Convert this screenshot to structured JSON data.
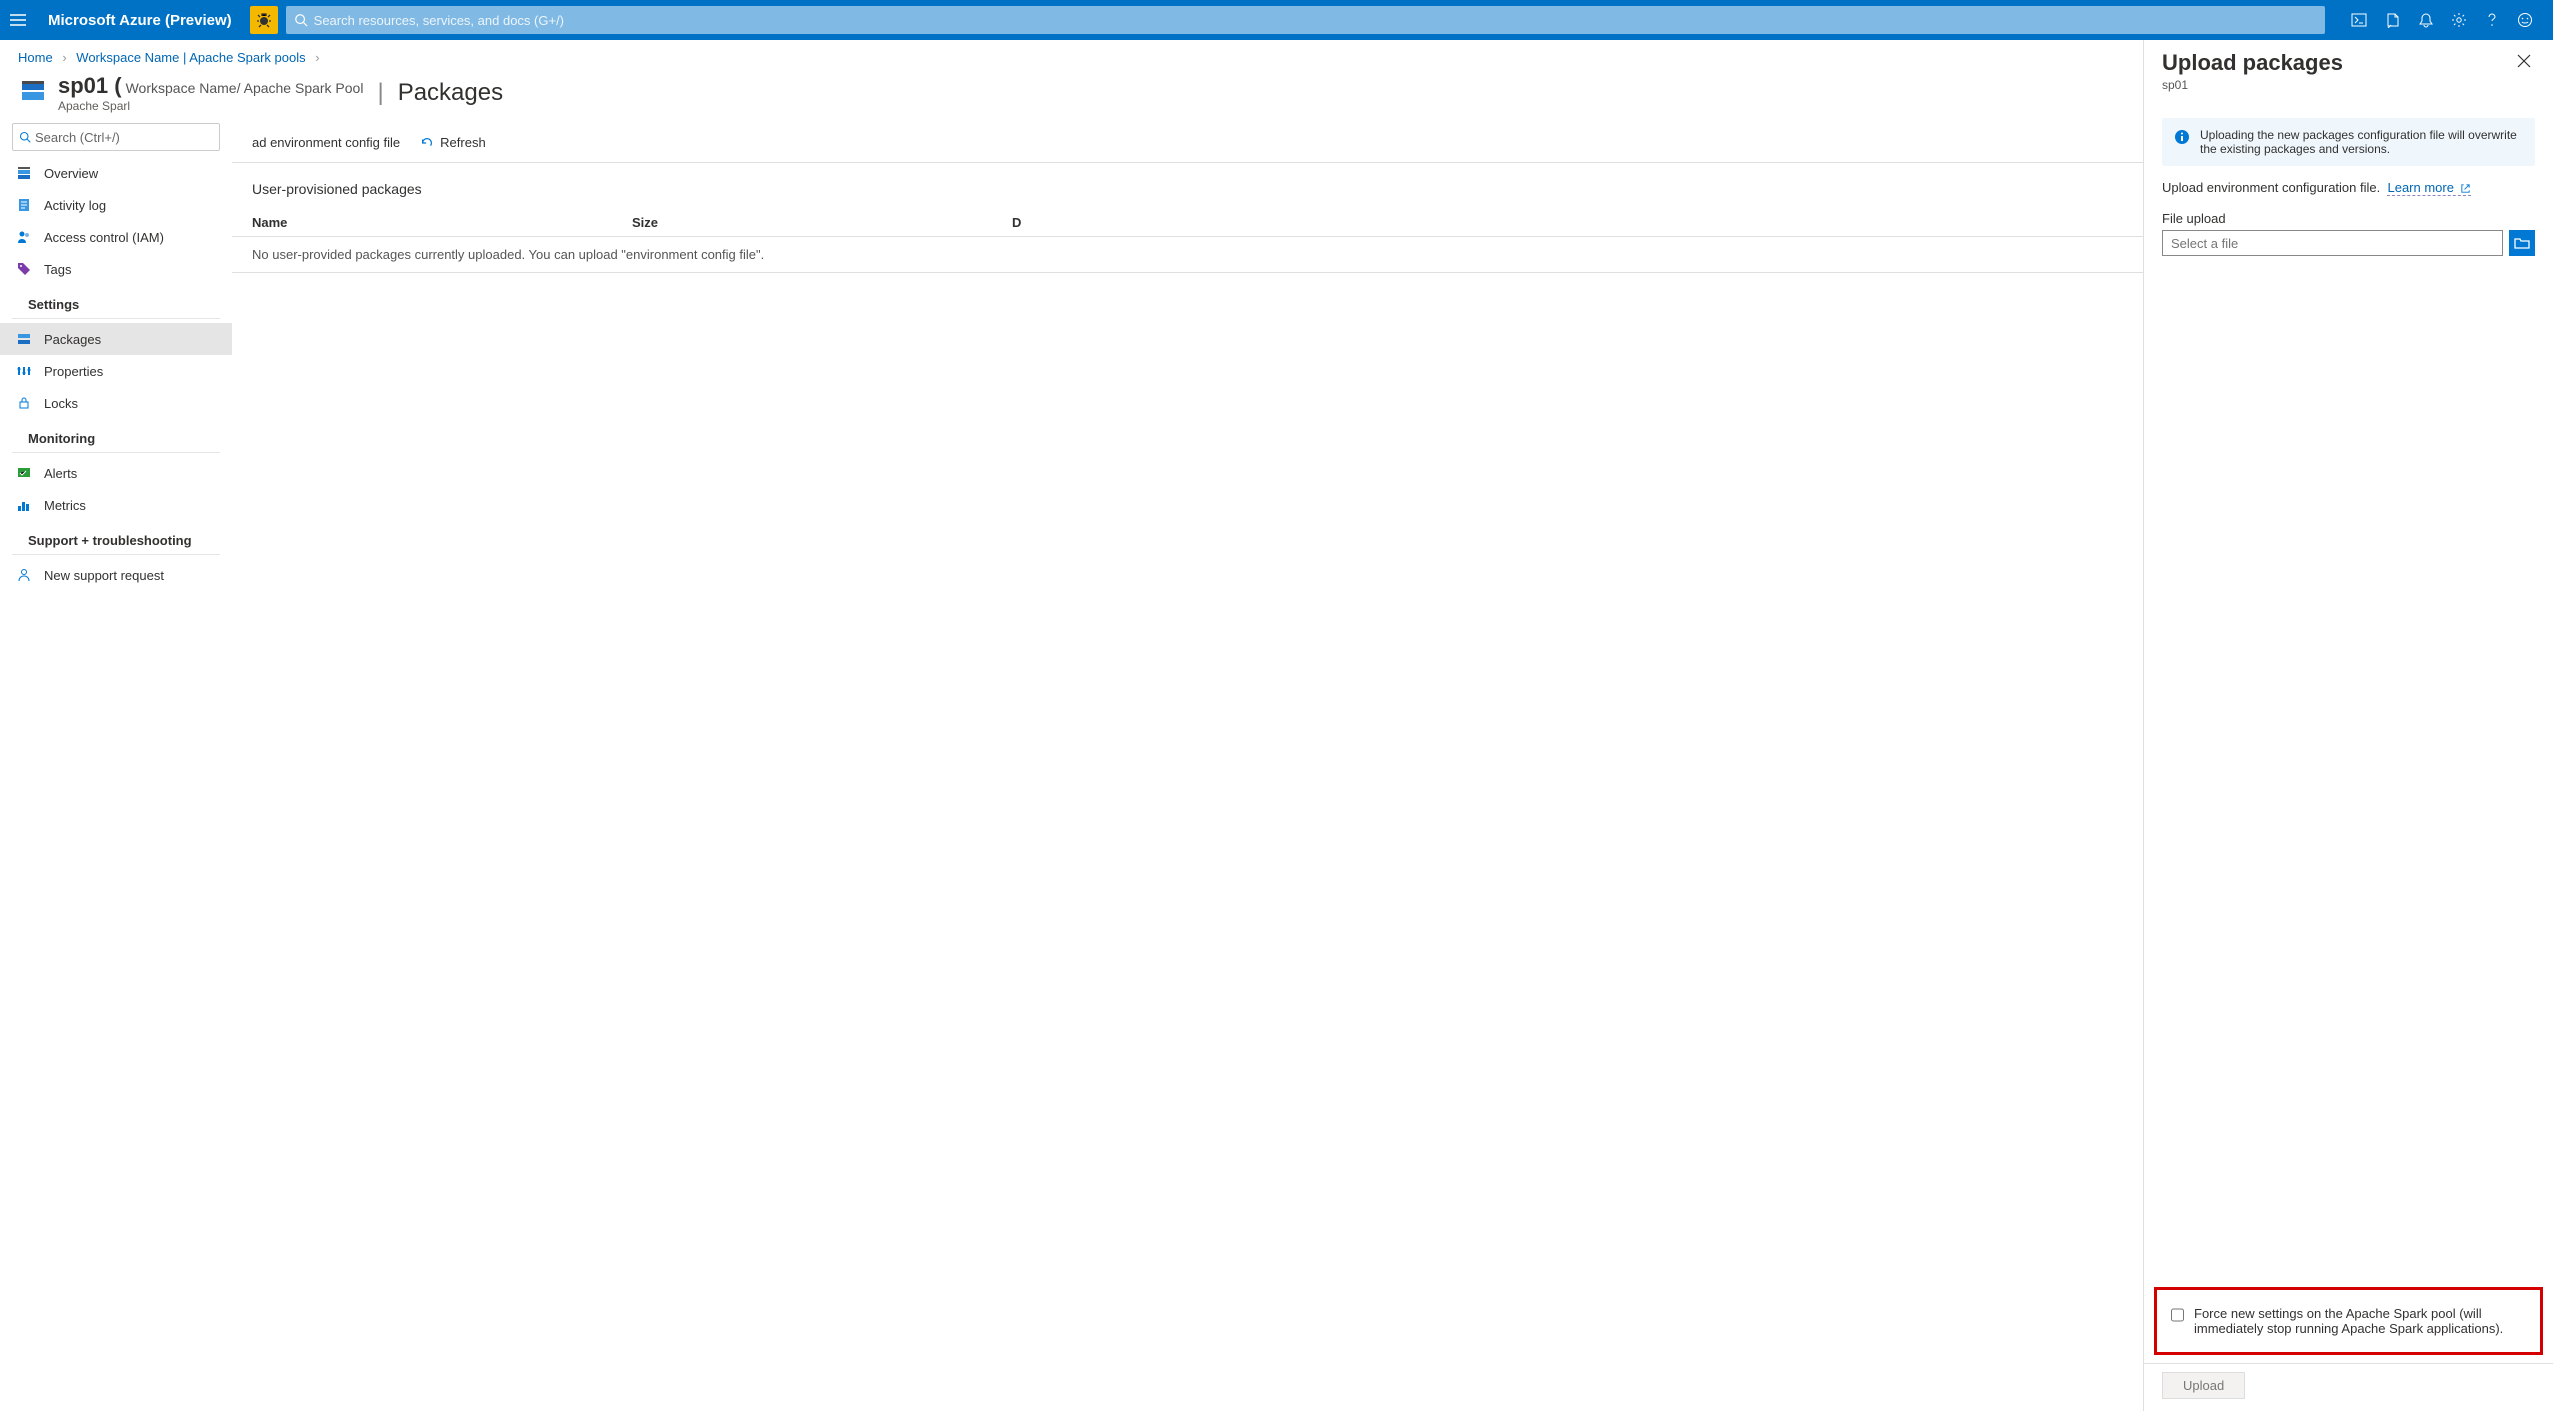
{
  "header": {
    "product": "Microsoft Azure (Preview)",
    "search_placeholder": "Search resources, services, and docs (G+/)"
  },
  "breadcrumb": {
    "items": [
      "Home",
      "Workspace Name | Apache Spark pools"
    ]
  },
  "resource": {
    "name": "sp01 (",
    "context": "Workspace Name/ Apache Spark Pool",
    "type": "Apache Sparl",
    "page_title": "Packages"
  },
  "sidebar": {
    "search_placeholder": "Search (Ctrl+/)",
    "groups": [
      {
        "title": "",
        "items": [
          {
            "label": "Overview",
            "icon": "overview"
          },
          {
            "label": "Activity log",
            "icon": "activity"
          },
          {
            "label": "Access control (IAM)",
            "icon": "iam"
          },
          {
            "label": "Tags",
            "icon": "tags"
          }
        ]
      },
      {
        "title": "Settings",
        "items": [
          {
            "label": "Packages",
            "icon": "packages",
            "selected": true
          },
          {
            "label": "Properties",
            "icon": "props"
          },
          {
            "label": "Locks",
            "icon": "locks"
          }
        ]
      },
      {
        "title": "Monitoring",
        "items": [
          {
            "label": "Alerts",
            "icon": "alerts"
          },
          {
            "label": "Metrics",
            "icon": "metrics"
          }
        ]
      },
      {
        "title": "Support + troubleshooting",
        "items": [
          {
            "label": "New support request",
            "icon": "support"
          }
        ]
      }
    ]
  },
  "toolbar": {
    "item1": "ad environment config file",
    "item2": "Refresh"
  },
  "packages": {
    "section": "User-provisioned packages",
    "cols": {
      "name": "Name",
      "size": "Size",
      "date": "D"
    },
    "empty": "No user-provided packages currently uploaded. You can upload \"environment config file\"."
  },
  "panel": {
    "title": "Upload packages",
    "subtitle": "sp01",
    "info": "Uploading the new packages configuration file will overwrite the existing packages and versions.",
    "desc": "Upload environment configuration file.",
    "learn": "Learn more",
    "file_label": "File upload",
    "file_placeholder": "Select a file",
    "force_label": "Force new settings on the Apache Spark pool (will immediately stop running Apache Spark applications).",
    "upload_btn": "Upload"
  }
}
